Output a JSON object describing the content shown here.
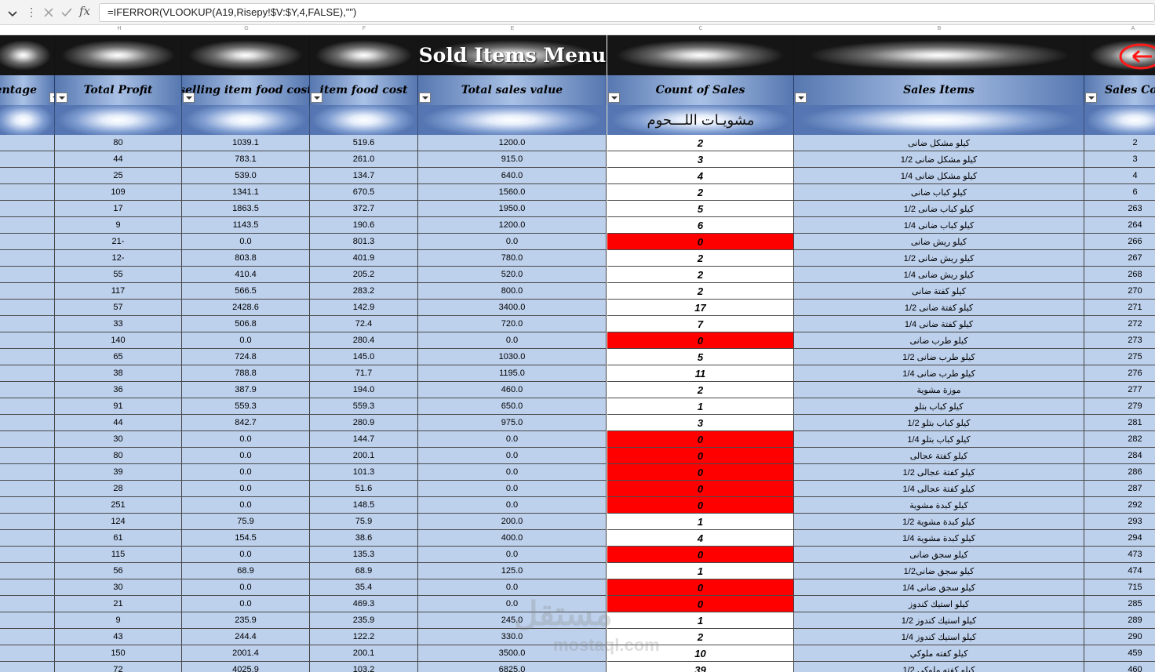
{
  "formula_bar": {
    "formula": "=IFERROR(VLOOKUP(A19,Risepy!$V:$Y,4,FALSE),\"\")",
    "fx_label": "fx"
  },
  "column_letters": [
    "H",
    "G",
    "F",
    "E",
    "C",
    "B",
    "A"
  ],
  "sheet": {
    "title": "Sold Items Menu",
    "section": "مشويـات اللـــحوم",
    "headers": {
      "percentage": "Percentage",
      "total_profit": "Total Profit",
      "selling_food_cost": "selling item food cost",
      "item_food_cost": "item food cost",
      "total_sales_value": "Total sales value",
      "count_of_sales": "Count of Sales",
      "sales_items": "Sales Items",
      "sales_code": "Sales Code"
    },
    "rows": [
      {
        "profit": "80",
        "selling": "1039.1",
        "cost": "519.6",
        "sales": "1200.0",
        "count": "2",
        "name": "كيلو مشكل ضانى",
        "code": "2"
      },
      {
        "profit": "44",
        "selling": "783.1",
        "cost": "261.0",
        "sales": "915.0",
        "count": "3",
        "name": "1/2 كيلو مشكل ضانى",
        "code": "3"
      },
      {
        "profit": "25",
        "selling": "539.0",
        "cost": "134.7",
        "sales": "640.0",
        "count": "4",
        "name": "1/4 كيلو مشكل ضانى",
        "code": "4"
      },
      {
        "profit": "109",
        "selling": "1341.1",
        "cost": "670.5",
        "sales": "1560.0",
        "count": "2",
        "name": "كيلو كباب ضانى",
        "code": "6"
      },
      {
        "profit": "17",
        "selling": "1863.5",
        "cost": "372.7",
        "sales": "1950.0",
        "count": "5",
        "name": "1/2 كيلو كباب ضانى",
        "code": "263"
      },
      {
        "profit": "9",
        "selling": "1143.5",
        "cost": "190.6",
        "sales": "1200.0",
        "count": "6",
        "name": "1/4 كيلو كباب ضانى",
        "code": "264"
      },
      {
        "profit": "21-",
        "selling": "0.0",
        "cost": "801.3",
        "sales": "0.0",
        "count": "0",
        "name": "كيلو ريش ضانى",
        "code": "266"
      },
      {
        "profit": "12-",
        "selling": "803.8",
        "cost": "401.9",
        "sales": "780.0",
        "count": "2",
        "name": "1/2 كيلو ريش ضانى",
        "code": "267"
      },
      {
        "profit": "55",
        "selling": "410.4",
        "cost": "205.2",
        "sales": "520.0",
        "count": "2",
        "name": "1/4 كيلو ريش ضانى",
        "code": "268"
      },
      {
        "profit": "117",
        "selling": "566.5",
        "cost": "283.2",
        "sales": "800.0",
        "count": "2",
        "name": "كيلو كفتة ضانى",
        "code": "270"
      },
      {
        "profit": "57",
        "selling": "2428.6",
        "cost": "142.9",
        "sales": "3400.0",
        "count": "17",
        "name": "1/2 كيلو كفتة ضانى",
        "code": "271"
      },
      {
        "profit": "33",
        "selling": "506.8",
        "cost": "72.4",
        "sales": "720.0",
        "count": "7",
        "name": "1/4 كيلو كفتة ضانى",
        "code": "272"
      },
      {
        "profit": "140",
        "selling": "0.0",
        "cost": "280.4",
        "sales": "0.0",
        "count": "0",
        "name": "كيلو طرب ضانى",
        "code": "273"
      },
      {
        "profit": "65",
        "selling": "724.8",
        "cost": "145.0",
        "sales": "1030.0",
        "count": "5",
        "name": "1/2 كيلو طرب ضانى",
        "code": "275"
      },
      {
        "profit": "38",
        "selling": "788.8",
        "cost": "71.7",
        "sales": "1195.0",
        "count": "11",
        "name": "1/4 كيلو طرب ضانى",
        "code": "276"
      },
      {
        "profit": "36",
        "selling": "387.9",
        "cost": "194.0",
        "sales": "460.0",
        "count": "2",
        "name": "موزة مشوية",
        "code": "277"
      },
      {
        "profit": "91",
        "selling": "559.3",
        "cost": "559.3",
        "sales": "650.0",
        "count": "1",
        "name": "كيلو كباب بتلو",
        "code": "279"
      },
      {
        "profit": "44",
        "selling": "842.7",
        "cost": "280.9",
        "sales": "975.0",
        "count": "3",
        "name": "1/2 كيلو كباب بتلو",
        "code": "281"
      },
      {
        "profit": "30",
        "selling": "0.0",
        "cost": "144.7",
        "sales": "0.0",
        "count": "0",
        "name": "1/4 كيلو كباب بتلو",
        "code": "282"
      },
      {
        "profit": "80",
        "selling": "0.0",
        "cost": "200.1",
        "sales": "0.0",
        "count": "0",
        "name": "كيلو كفتة عجالى",
        "code": "284"
      },
      {
        "profit": "39",
        "selling": "0.0",
        "cost": "101.3",
        "sales": "0.0",
        "count": "0",
        "name": "1/2 كيلو كفتة عجالى",
        "code": "286"
      },
      {
        "profit": "28",
        "selling": "0.0",
        "cost": "51.6",
        "sales": "0.0",
        "count": "0",
        "name": "1/4 كيلو كفتة عجالى",
        "code": "287"
      },
      {
        "profit": "251",
        "selling": "0.0",
        "cost": "148.5",
        "sales": "0.0",
        "count": "0",
        "name": "كيلو كبدة مشوية",
        "code": "292"
      },
      {
        "profit": "124",
        "selling": "75.9",
        "cost": "75.9",
        "sales": "200.0",
        "count": "1",
        "name": "1/2 كيلو كبدة مشوية",
        "code": "293"
      },
      {
        "profit": "61",
        "selling": "154.5",
        "cost": "38.6",
        "sales": "400.0",
        "count": "4",
        "name": "1/4 كيلو كبدة مشوية",
        "code": "294"
      },
      {
        "profit": "115",
        "selling": "0.0",
        "cost": "135.3",
        "sales": "0.0",
        "count": "0",
        "name": "كيلو سجق ضانى",
        "code": "473"
      },
      {
        "profit": "56",
        "selling": "68.9",
        "cost": "68.9",
        "sales": "125.0",
        "count": "1",
        "name": "1/2كيلو سجق ضانى",
        "code": "474"
      },
      {
        "profit": "30",
        "selling": "0.0",
        "cost": "35.4",
        "sales": "0.0",
        "count": "0",
        "name": "1/4 كيلو سجق ضانى",
        "code": "715"
      },
      {
        "profit": "21",
        "selling": "0.0",
        "cost": "469.3",
        "sales": "0.0",
        "count": "0",
        "name": "كيلو استيك كندوز",
        "code": "285"
      },
      {
        "profit": "9",
        "selling": "235.9",
        "cost": "235.9",
        "sales": "245.0",
        "count": "1",
        "name": "1/2 كيلو استيك كندوز",
        "code": "289"
      },
      {
        "profit": "43",
        "selling": "244.4",
        "cost": "122.2",
        "sales": "330.0",
        "count": "2",
        "name": "1/4 كيلو استيك كندوز",
        "code": "290"
      },
      {
        "profit": "150",
        "selling": "2001.4",
        "cost": "200.1",
        "sales": "3500.0",
        "count": "10",
        "name": "كيلو كفته ملوكي",
        "code": "459"
      },
      {
        "profit": "72",
        "selling": "4025.9",
        "cost": "103.2",
        "sales": "6825.0",
        "count": "39",
        "name": "1/2 كيلو كفته ملوكي",
        "code": "460"
      }
    ]
  },
  "watermark": {
    "arabic": "مستقل",
    "latin": "mostaql.com"
  },
  "colors": {
    "count_zero": "#ff0000",
    "row_fill": "#bdd0ec",
    "header_fill": "#8eaadb"
  }
}
